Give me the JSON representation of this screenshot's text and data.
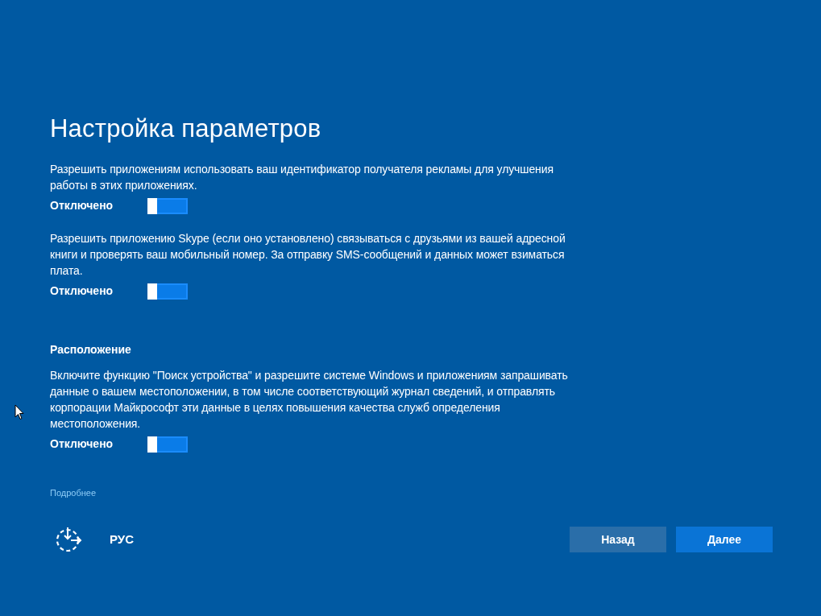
{
  "title": "Настройка параметров",
  "settings": [
    {
      "description": "Разрешить приложениям использовать ваш идентификатор получателя рекламы для улучшения работы в этих приложениях.",
      "status": "Отключено",
      "on": false
    },
    {
      "description": "Разрешить приложению Skype (если оно установлено) связываться с друзьями из вашей адресной книги и проверять ваш мобильный номер. За отправку SMS-сообщений и данных может взиматься плата.",
      "status": "Отключено",
      "on": false
    },
    {
      "heading": "Расположение",
      "description": "Включите функцию \"Поиск устройства\" и разрешите системе Windows и приложениям запрашивать данные о вашем местоположении, в том числе соответствующий журнал сведений, и отправлять корпорации Майкрософт эти данные в целях повышения качества служб определения местоположения.",
      "status": "Отключено",
      "on": false
    }
  ],
  "link": "Подробнее",
  "language": "РУС",
  "buttons": [
    {
      "label": "Назад",
      "kind": "secondary"
    },
    {
      "label": "Далее",
      "kind": "primary"
    }
  ]
}
